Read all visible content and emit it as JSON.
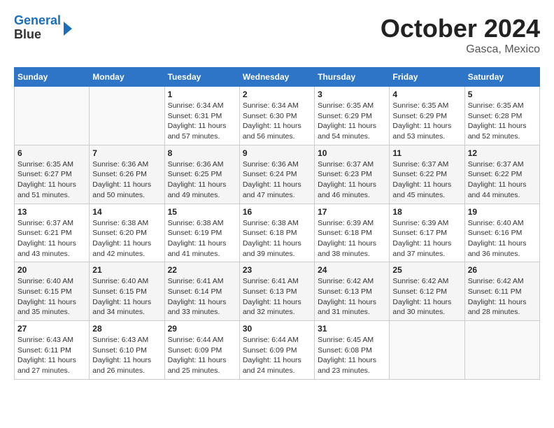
{
  "logo": {
    "line1": "General",
    "line2": "Blue"
  },
  "title": "October 2024",
  "location": "Gasca, Mexico",
  "weekdays": [
    "Sunday",
    "Monday",
    "Tuesday",
    "Wednesday",
    "Thursday",
    "Friday",
    "Saturday"
  ],
  "weeks": [
    [
      {
        "day": "",
        "info": ""
      },
      {
        "day": "",
        "info": ""
      },
      {
        "day": "1",
        "info": "Sunrise: 6:34 AM\nSunset: 6:31 PM\nDaylight: 11 hours and 57 minutes."
      },
      {
        "day": "2",
        "info": "Sunrise: 6:34 AM\nSunset: 6:30 PM\nDaylight: 11 hours and 56 minutes."
      },
      {
        "day": "3",
        "info": "Sunrise: 6:35 AM\nSunset: 6:29 PM\nDaylight: 11 hours and 54 minutes."
      },
      {
        "day": "4",
        "info": "Sunrise: 6:35 AM\nSunset: 6:29 PM\nDaylight: 11 hours and 53 minutes."
      },
      {
        "day": "5",
        "info": "Sunrise: 6:35 AM\nSunset: 6:28 PM\nDaylight: 11 hours and 52 minutes."
      }
    ],
    [
      {
        "day": "6",
        "info": "Sunrise: 6:35 AM\nSunset: 6:27 PM\nDaylight: 11 hours and 51 minutes."
      },
      {
        "day": "7",
        "info": "Sunrise: 6:36 AM\nSunset: 6:26 PM\nDaylight: 11 hours and 50 minutes."
      },
      {
        "day": "8",
        "info": "Sunrise: 6:36 AM\nSunset: 6:25 PM\nDaylight: 11 hours and 49 minutes."
      },
      {
        "day": "9",
        "info": "Sunrise: 6:36 AM\nSunset: 6:24 PM\nDaylight: 11 hours and 47 minutes."
      },
      {
        "day": "10",
        "info": "Sunrise: 6:37 AM\nSunset: 6:23 PM\nDaylight: 11 hours and 46 minutes."
      },
      {
        "day": "11",
        "info": "Sunrise: 6:37 AM\nSunset: 6:22 PM\nDaylight: 11 hours and 45 minutes."
      },
      {
        "day": "12",
        "info": "Sunrise: 6:37 AM\nSunset: 6:22 PM\nDaylight: 11 hours and 44 minutes."
      }
    ],
    [
      {
        "day": "13",
        "info": "Sunrise: 6:37 AM\nSunset: 6:21 PM\nDaylight: 11 hours and 43 minutes."
      },
      {
        "day": "14",
        "info": "Sunrise: 6:38 AM\nSunset: 6:20 PM\nDaylight: 11 hours and 42 minutes."
      },
      {
        "day": "15",
        "info": "Sunrise: 6:38 AM\nSunset: 6:19 PM\nDaylight: 11 hours and 41 minutes."
      },
      {
        "day": "16",
        "info": "Sunrise: 6:38 AM\nSunset: 6:18 PM\nDaylight: 11 hours and 39 minutes."
      },
      {
        "day": "17",
        "info": "Sunrise: 6:39 AM\nSunset: 6:18 PM\nDaylight: 11 hours and 38 minutes."
      },
      {
        "day": "18",
        "info": "Sunrise: 6:39 AM\nSunset: 6:17 PM\nDaylight: 11 hours and 37 minutes."
      },
      {
        "day": "19",
        "info": "Sunrise: 6:40 AM\nSunset: 6:16 PM\nDaylight: 11 hours and 36 minutes."
      }
    ],
    [
      {
        "day": "20",
        "info": "Sunrise: 6:40 AM\nSunset: 6:15 PM\nDaylight: 11 hours and 35 minutes."
      },
      {
        "day": "21",
        "info": "Sunrise: 6:40 AM\nSunset: 6:15 PM\nDaylight: 11 hours and 34 minutes."
      },
      {
        "day": "22",
        "info": "Sunrise: 6:41 AM\nSunset: 6:14 PM\nDaylight: 11 hours and 33 minutes."
      },
      {
        "day": "23",
        "info": "Sunrise: 6:41 AM\nSunset: 6:13 PM\nDaylight: 11 hours and 32 minutes."
      },
      {
        "day": "24",
        "info": "Sunrise: 6:42 AM\nSunset: 6:13 PM\nDaylight: 11 hours and 31 minutes."
      },
      {
        "day": "25",
        "info": "Sunrise: 6:42 AM\nSunset: 6:12 PM\nDaylight: 11 hours and 30 minutes."
      },
      {
        "day": "26",
        "info": "Sunrise: 6:42 AM\nSunset: 6:11 PM\nDaylight: 11 hours and 28 minutes."
      }
    ],
    [
      {
        "day": "27",
        "info": "Sunrise: 6:43 AM\nSunset: 6:11 PM\nDaylight: 11 hours and 27 minutes."
      },
      {
        "day": "28",
        "info": "Sunrise: 6:43 AM\nSunset: 6:10 PM\nDaylight: 11 hours and 26 minutes."
      },
      {
        "day": "29",
        "info": "Sunrise: 6:44 AM\nSunset: 6:09 PM\nDaylight: 11 hours and 25 minutes."
      },
      {
        "day": "30",
        "info": "Sunrise: 6:44 AM\nSunset: 6:09 PM\nDaylight: 11 hours and 24 minutes."
      },
      {
        "day": "31",
        "info": "Sunrise: 6:45 AM\nSunset: 6:08 PM\nDaylight: 11 hours and 23 minutes."
      },
      {
        "day": "",
        "info": ""
      },
      {
        "day": "",
        "info": ""
      }
    ]
  ]
}
